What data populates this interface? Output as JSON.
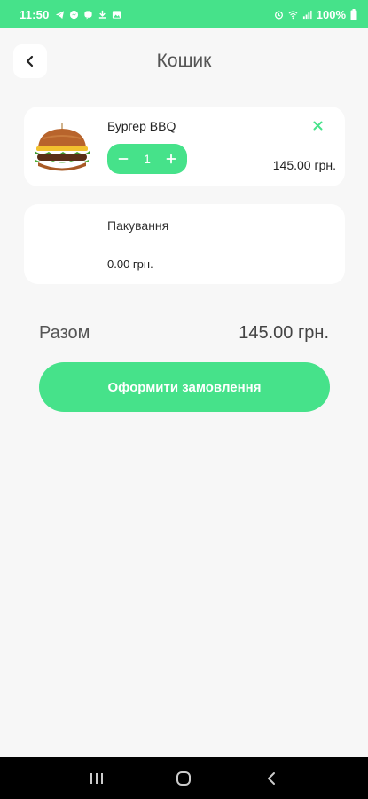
{
  "status_bar": {
    "time": "11:50",
    "battery": "100%",
    "left_icons": [
      "telegram-icon",
      "messenger-icon",
      "viber-icon",
      "download-icon",
      "gallery-icon"
    ],
    "right_icons": [
      "alarm-icon",
      "wifi-icon",
      "signal-icon"
    ]
  },
  "header": {
    "title": "Кошик",
    "back_icon": "chevron-left-icon"
  },
  "cart": {
    "items": [
      {
        "name": "Бургер BBQ",
        "quantity": "1",
        "price": "145.00 грн.",
        "image": "burger-image",
        "remove_icon": "close-icon"
      }
    ],
    "packaging": {
      "label": "Пакування",
      "price": "0.00 грн."
    }
  },
  "summary": {
    "total_label": "Разом",
    "total_value": "145.00 грн."
  },
  "checkout": {
    "label": "Оформити замовлення"
  },
  "colors": {
    "accent": "#46e28a",
    "background": "#f7f7f7",
    "card": "#ffffff",
    "nav_bar": "#000000"
  },
  "nav_bar": {
    "icons": [
      "recent-apps-icon",
      "home-icon",
      "back-icon"
    ]
  }
}
